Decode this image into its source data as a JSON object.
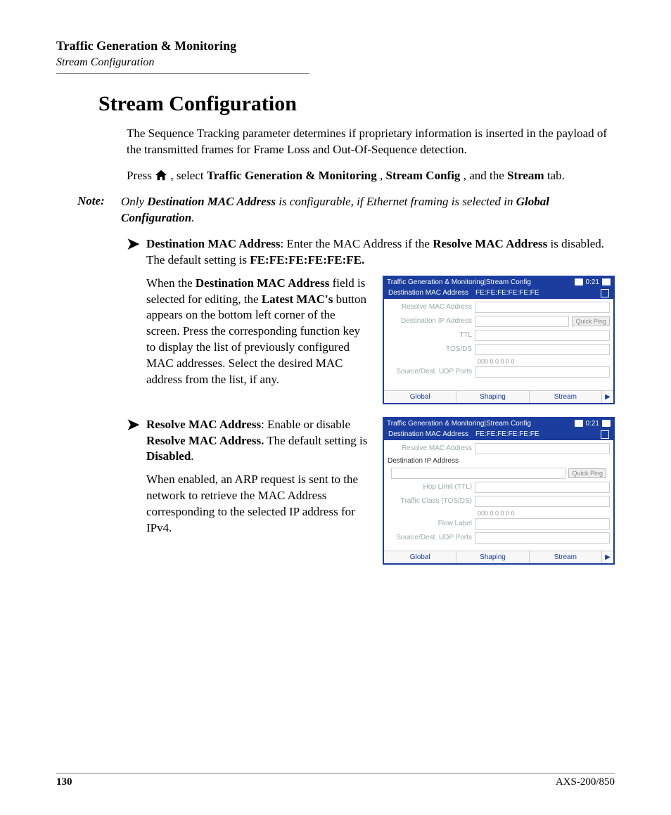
{
  "header": {
    "title": "Traffic Generation & Monitoring",
    "subtitle": "Stream Configuration"
  },
  "main_title": "Stream Configuration",
  "intro": {
    "p1": "The Sequence Tracking parameter determines if proprietary information is inserted in the payload of the transmitted frames for Frame Loss and Out-Of-Sequence detection.",
    "p2_pre": "Press ",
    "p2_mid1": ", select ",
    "p2_bold1": "Traffic Generation & Monitoring",
    "p2_mid2": ", ",
    "p2_bold2": "Stream Config",
    "p2_mid3": ", and the ",
    "p2_bold3": "Stream",
    "p2_end": " tab."
  },
  "note": {
    "label": "Note:",
    "t1": "Only ",
    "b1": "Destination MAC Address",
    "t2": " is configurable, if Ethernet framing is selected in ",
    "b2": "Global Configuration",
    "t3": "."
  },
  "bullet1": {
    "b1": "Destination MAC Address",
    "t1": ": Enter the MAC Address if the ",
    "b2": "Resolve MAC Address",
    "t2": " is disabled. The default setting is ",
    "b3": "FE:FE:FE:FE:FE:FE."
  },
  "col1a": {
    "t1": "When the ",
    "b1": "Destination MAC Address",
    "t2": " field is selected for editing, the ",
    "b2": "Latest MAC's",
    "t3": " button appears on the bottom left corner of the screen. Press the corresponding function key to display the list of previously configured MAC addresses. Select the desired MAC address from the list, if any."
  },
  "bullet2": {
    "b1": "Resolve MAC Address",
    "t1": ": Enable or disable ",
    "b2": "Resolve MAC Address.",
    "t2": " The default setting is ",
    "b3": "Disabled",
    "t3": "."
  },
  "col2a": {
    "p": "When enabled, an ARP request is sent to the network to retrieve the MAC Address corresponding to the selected IP address for IPv4."
  },
  "shot1": {
    "top_title": "Traffic Generation  & Monitoring|Stream Config",
    "time": "0:21",
    "sel_label": "Destination MAC Address",
    "sel_val": "FE:FE:FE:FE:FE:FE",
    "rows": {
      "r1": "Resolve MAC Address",
      "r2": "Destination IP Address",
      "r3": "TTL",
      "r4": "TOS/DS",
      "r5": "Source/Dest. UDP Ports"
    },
    "quick_ping": "Quick Ping",
    "bits": "000 0 0 0 0 0",
    "tabs": {
      "t1": "Global",
      "t2": "Shaping",
      "t3": "Stream"
    }
  },
  "shot2": {
    "top_title": "Traffic Generation  & Monitoring|Stream Config",
    "time": "0:21",
    "sel_label": "Destination MAC Address",
    "sel_val": "FE:FE:FE:FE:FE:FE",
    "rows": {
      "r1": "Resolve MAC Address",
      "r2": "Destination IP Address",
      "r3": "Hop Limit (TTL)",
      "r4": "Traffic Class (TOS/DS)",
      "r5": "Flow Label",
      "r6": "Source/Dest. UDP Ports"
    },
    "quick_ping": "Quick Ping",
    "bits": "000 0 0 0 0 0",
    "tabs": {
      "t1": "Global",
      "t2": "Shaping",
      "t3": "Stream"
    }
  },
  "footer": {
    "page": "130",
    "doc": "AXS-200/850"
  }
}
